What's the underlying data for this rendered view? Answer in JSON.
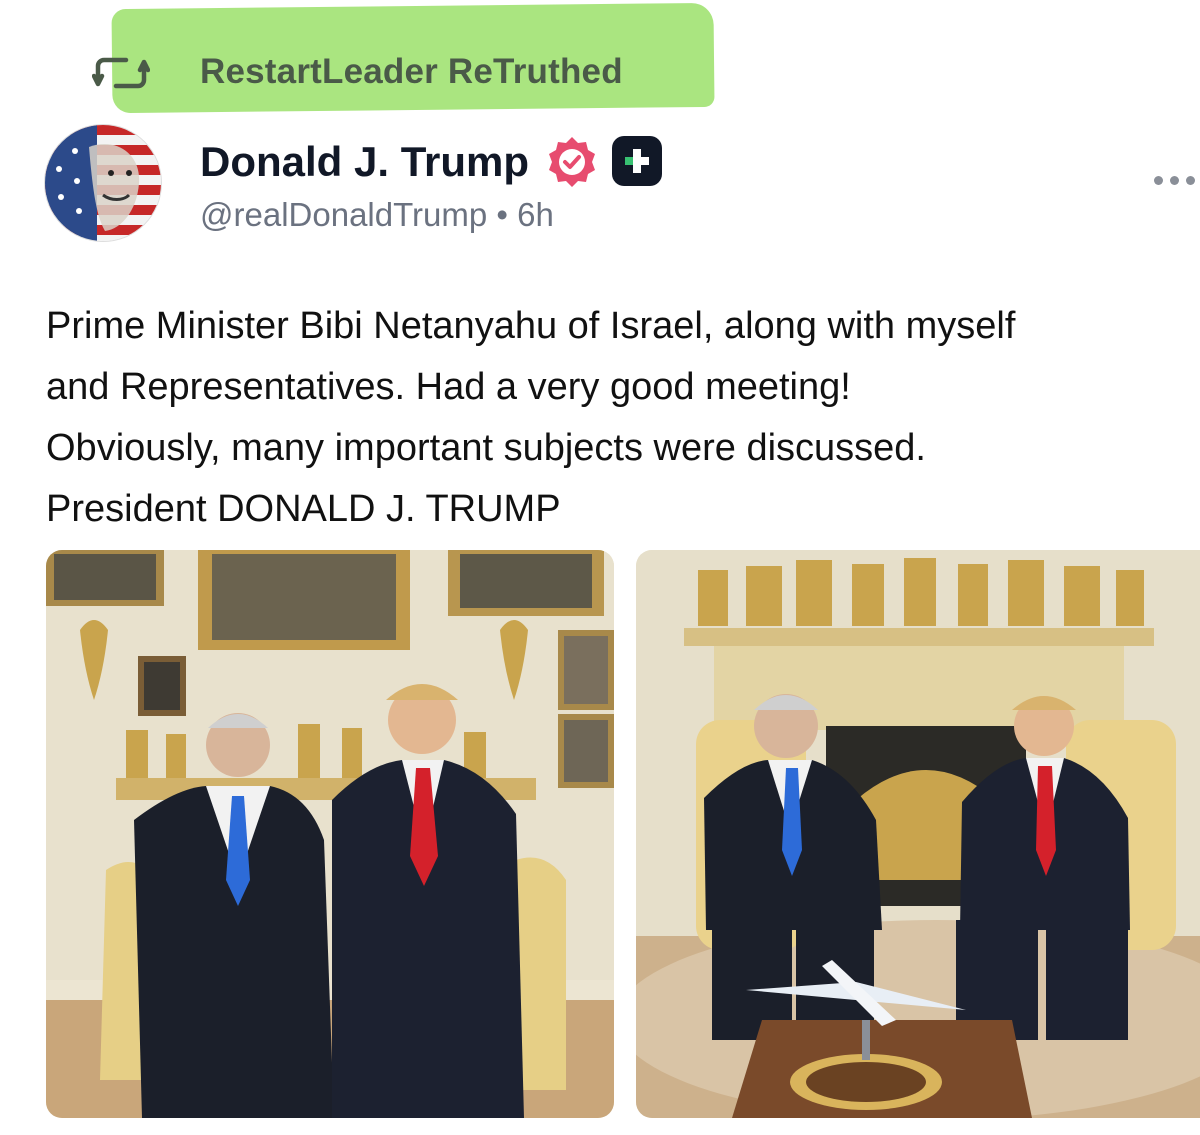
{
  "retruth": {
    "label": "RestartLeader ReTruthed",
    "icon": "retruth-icon",
    "highlight_color": "#9be06a"
  },
  "author": {
    "name": "Donald J. Trump",
    "handle": "@realDonaldTrump",
    "separator": "•",
    "time": "6h",
    "verified_icon": "verified-badge-icon",
    "verified_color": "#e74c6f",
    "plus_icon": "plus-badge-icon",
    "avatar_icon": "avatar"
  },
  "menu": {
    "icon": "more-options-icon"
  },
  "post": {
    "lines": [
      "Prime Minister Bibi Netanyahu of Israel, along with myself",
      "and Representatives. Had a very good meeting!",
      "Obviously, many important subjects were discussed.",
      "President DONALD J. TRUMP"
    ]
  },
  "media": [
    {
      "kind": "photo",
      "subject": "two men standing in suits"
    },
    {
      "kind": "photo",
      "subject": "two men seated by fireplace"
    }
  ]
}
